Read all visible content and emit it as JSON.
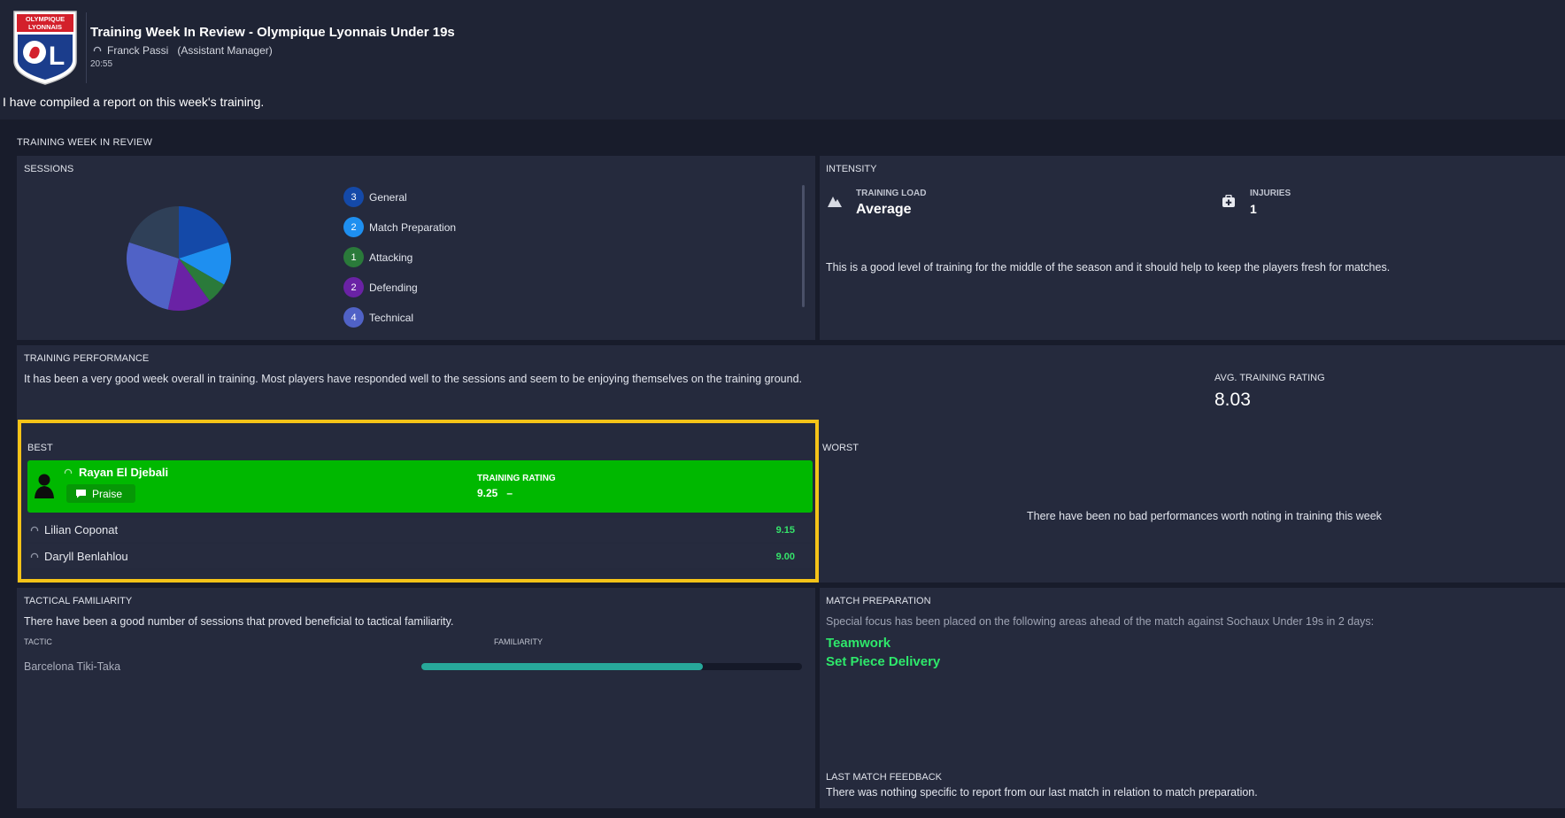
{
  "header": {
    "club_crest_text": [
      "OLYMPIQUE",
      "LYONNAIS"
    ],
    "title": "Training Week In Review - Olympique Lyonnais Under 19s",
    "sender_name": "Franck Passi",
    "sender_role": "(Assistant Manager)",
    "time": "20:55",
    "intro": "I have compiled a report on this week's training."
  },
  "section_title": "TRAINING WEEK IN REVIEW",
  "sessions": {
    "title": "SESSIONS",
    "items": [
      {
        "count": "3",
        "label": "General",
        "color": "#1449a8"
      },
      {
        "count": "2",
        "label": "Match Preparation",
        "color": "#1e8ff0"
      },
      {
        "count": "1",
        "label": "Attacking",
        "color": "#2a7a3a"
      },
      {
        "count": "2",
        "label": "Defending",
        "color": "#6a22a5"
      },
      {
        "count": "4",
        "label": "Technical",
        "color": "#5062c6"
      }
    ],
    "extra_slice_color": "#2f4058"
  },
  "intensity": {
    "title": "INTENSITY",
    "load_label": "TRAINING LOAD",
    "load_value": "Average",
    "injuries_label": "INJURIES",
    "injuries_value": "1",
    "comment": "This is a good level of training for the middle of the season and it should help to keep the players fresh for matches."
  },
  "performance": {
    "title": "TRAINING PERFORMANCE",
    "summary": "It has been a very good week overall in training. Most players have responded well to the sessions and seem to be enjoying themselves on the training ground.",
    "avg_label": "AVG. TRAINING RATING",
    "avg_value": "8.03",
    "best_label": "BEST",
    "worst_label": "WORST",
    "best_player": {
      "name": "Rayan El Djebali",
      "action": "Praise",
      "rating_label": "TRAINING RATING",
      "rating": "9.25",
      "trend": "–"
    },
    "others": [
      {
        "name": "Lilian Coponat",
        "rating": "9.15"
      },
      {
        "name": "Daryll Benlahlou",
        "rating": "9.00"
      }
    ],
    "worst_empty": "There have been no bad performances worth noting in training this week"
  },
  "tactical": {
    "title": "TACTICAL FAMILIARITY",
    "summary": "There have been a good number of sessions that proved beneficial to tactical familiarity.",
    "col_tactic": "TACTIC",
    "col_familiarity": "FAMILIARITY",
    "tactic_name": "Barcelona Tiki-Taka",
    "familiarity_fraction": 0.74
  },
  "match_prep": {
    "title": "MATCH PREPARATION",
    "intro": "Special focus has been placed on the following areas ahead of the match against Sochaux Under 19s in 2 days:",
    "areas": [
      "Teamwork",
      "Set Piece Delivery"
    ],
    "feedback_title": "LAST MATCH FEEDBACK",
    "feedback_text": "There was nothing specific to report from our last match in relation to match preparation."
  }
}
